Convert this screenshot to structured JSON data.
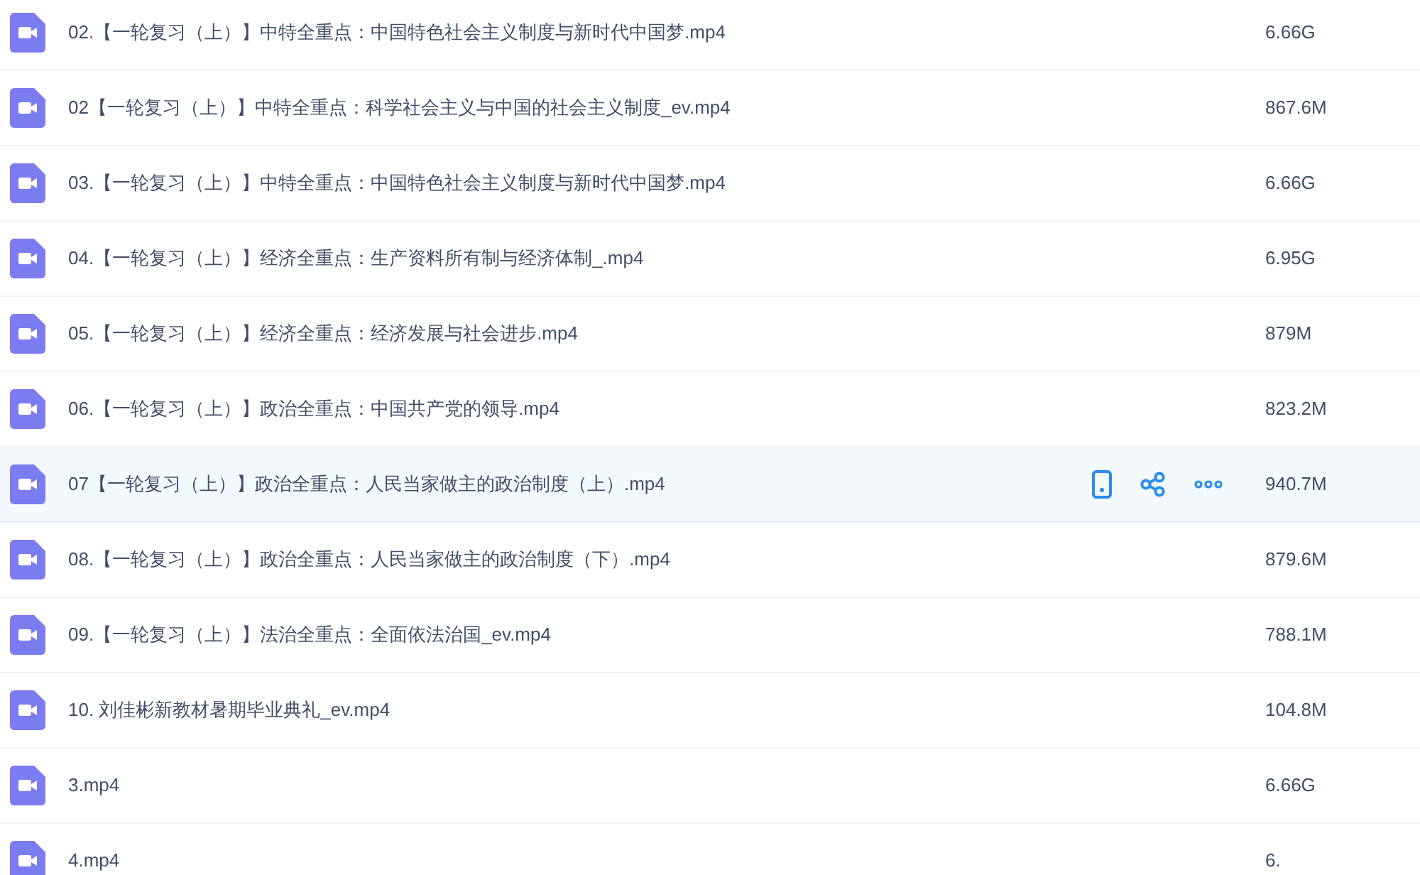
{
  "files": [
    {
      "name": "02.【一轮复习（上）】中特全重点：中国特色社会主义制度与新时代中国梦.mp4",
      "size": "6.66G",
      "selected": false
    },
    {
      "name": "02【一轮复习（上）】中特全重点：科学社会主义与中国的社会主义制度_ev.mp4",
      "size": "867.6M",
      "selected": false
    },
    {
      "name": "03.【一轮复习（上）】中特全重点：中国特色社会主义制度与新时代中国梦.mp4",
      "size": "6.66G",
      "selected": false
    },
    {
      "name": "04.【一轮复习（上）】经济全重点：生产资料所有制与经济体制_.mp4",
      "size": "6.95G",
      "selected": false
    },
    {
      "name": "05.【一轮复习（上）】经济全重点：经济发展与社会进步.mp4",
      "size": "879M",
      "selected": false
    },
    {
      "name": "06.【一轮复习（上）】政治全重点：中国共产党的领导.mp4",
      "size": "823.2M",
      "selected": false
    },
    {
      "name": "07【一轮复习（上）】政治全重点：人民当家做主的政治制度（上）.mp4",
      "size": "940.7M",
      "selected": true
    },
    {
      "name": "08.【一轮复习（上）】政治全重点：人民当家做主的政治制度（下）.mp4",
      "size": "879.6M",
      "selected": false
    },
    {
      "name": "09.【一轮复习（上）】法治全重点：全面依法治国_ev.mp4",
      "size": "788.1M",
      "selected": false
    },
    {
      "name": "10. 刘佳彬新教材暑期毕业典礼_ev.mp4",
      "size": "104.8M",
      "selected": false
    },
    {
      "name": "3.mp4",
      "size": "6.66G",
      "selected": false
    },
    {
      "name": "4.mp4",
      "size": "6.",
      "selected": false
    }
  ]
}
